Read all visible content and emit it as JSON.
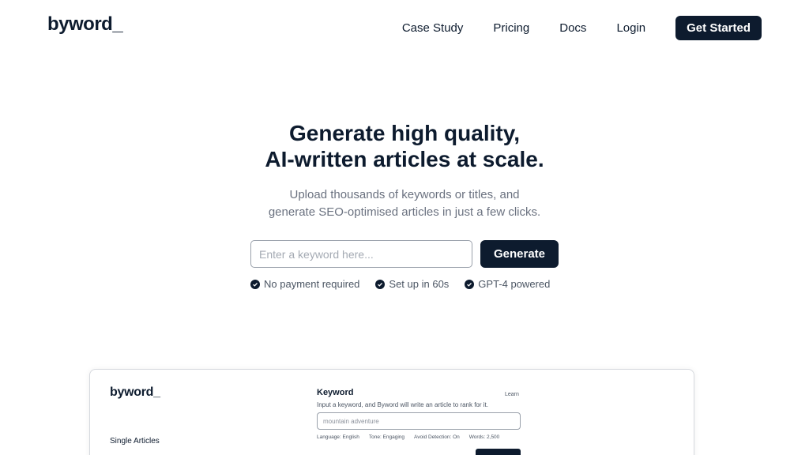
{
  "brand": {
    "logo": "byword_"
  },
  "nav": {
    "items": [
      "Case Study",
      "Pricing",
      "Docs",
      "Login"
    ],
    "cta": "Get Started"
  },
  "hero": {
    "title_line1": "Generate high quality,",
    "title_line2": "AI-written articles at scale.",
    "subtitle_line1": "Upload thousands of keywords or titles, and",
    "subtitle_line2": "generate SEO-optimised articles in just a few clicks.",
    "search_placeholder": "Enter a keyword here...",
    "generate_label": "Generate",
    "features": [
      "No payment required",
      "Set up in 60s",
      "GPT-4 powered"
    ]
  },
  "preview": {
    "logo": "byword_",
    "section_label": "Single Articles",
    "keyword_label": "Keyword",
    "learn_label": "Learn",
    "description": "Input a keyword, and Byword will write an article to rank for it.",
    "input_value": "mountain adventure",
    "meta": [
      "Language: English",
      "Tone: Engaging",
      "Avoid Detection: On",
      "Words: 2,500"
    ]
  },
  "colors": {
    "primary": "#0d1b2e",
    "muted_text": "#6b7280",
    "border": "#9aa1ab"
  }
}
